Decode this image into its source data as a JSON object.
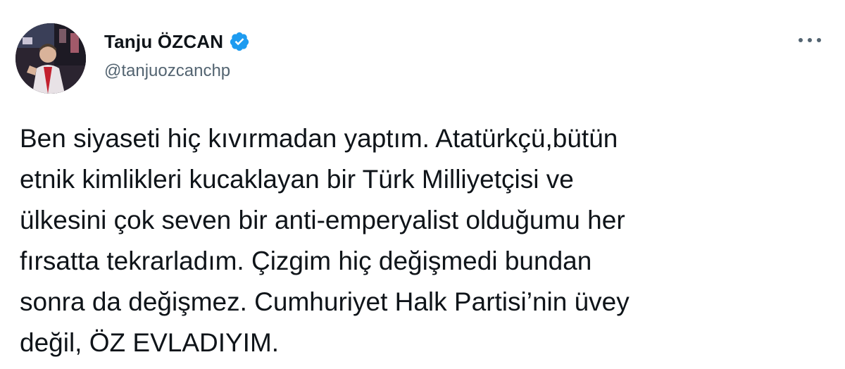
{
  "author": {
    "display_name": "Tanju ÖZCAN",
    "handle": "@tanjuozcanchp",
    "verified": true,
    "avatar_icon": "profile-photo"
  },
  "menu": {
    "icon": "more-horizontal-icon"
  },
  "tweet": {
    "lines": [
      "Ben siyaseti hiç kıvırmadan yaptım. Atatürkçü,bütün",
      "etnik kimlikleri kucaklayan bir Türk Milliyetçisi ve",
      "ülkesini çok seven bir anti-emperyalist olduğumu her",
      "fırsatta tekrarladım. Çizgim hiç değişmedi bundan",
      "sonra da değişmez. Cumhuriyet Halk Partisi’nin üvey",
      "değil, ÖZ EVLADIYIM."
    ]
  },
  "colors": {
    "text": "#0f1419",
    "secondary": "#536471",
    "verified": "#1d9bf0"
  }
}
